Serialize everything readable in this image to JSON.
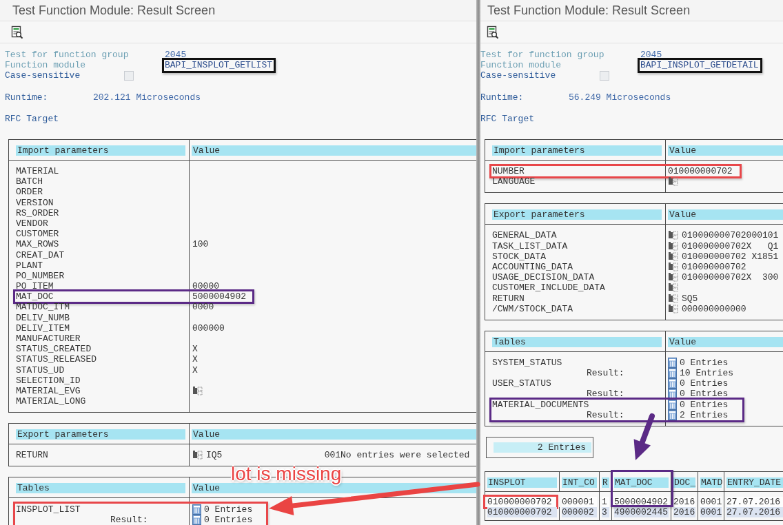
{
  "panes": [
    {
      "title": "Test Function Module: Result Screen",
      "group_label": "Test for function group",
      "group": "2045",
      "module_label": "Function module",
      "module": "BAPI_INSPLOT_GETLIST",
      "module_frame": {
        "color": "#111111"
      },
      "case_label": "Case-sensitive",
      "case_checked": false,
      "runtime_label": "Runtime:",
      "runtime": "202.121 Microseconds",
      "rfc": "RFC Target",
      "sections": [
        {
          "header": "Import parameters",
          "value_header": "Value",
          "rows": [
            {
              "kind": "plain",
              "name": "MATERIAL"
            },
            {
              "kind": "plain",
              "name": "BATCH"
            },
            {
              "kind": "plain",
              "name": "ORDER"
            },
            {
              "kind": "plain",
              "name": "VERSION"
            },
            {
              "kind": "plain",
              "name": "RS_ORDER"
            },
            {
              "kind": "plain",
              "name": "VENDOR"
            },
            {
              "kind": "plain",
              "name": "CUSTOMER"
            },
            {
              "kind": "plain",
              "name": "MAX_ROWS",
              "value": "100"
            },
            {
              "kind": "plain",
              "name": "CREAT_DAT"
            },
            {
              "kind": "plain",
              "name": "PLANT"
            },
            {
              "kind": "plain",
              "name": "PO_NUMBER"
            },
            {
              "kind": "plain",
              "name": "PO_ITEM",
              "value": "00000"
            },
            {
              "kind": "plain",
              "name": "MAT_DOC",
              "value": "5000004902",
              "color": "#5b2a86"
            },
            {
              "kind": "plain",
              "name": "MATDOC_ITM",
              "value": "0000"
            },
            {
              "kind": "plain",
              "name": "DELIV_NUMB"
            },
            {
              "kind": "plain",
              "name": "DELIV_ITEM",
              "value": "000000"
            },
            {
              "kind": "plain",
              "name": "MANUFACTURER"
            },
            {
              "kind": "plain",
              "name": "STATUS_CREATED",
              "value": "X"
            },
            {
              "kind": "plain",
              "name": "STATUS_RELEASED",
              "value": "X"
            },
            {
              "kind": "plain",
              "name": "STATUS_UD",
              "value": "X"
            },
            {
              "kind": "plain",
              "name": "SELECTION_ID"
            },
            {
              "kind": "struct",
              "name": "MATERIAL_EVG"
            },
            {
              "kind": "plain",
              "name": "MATERIAL_LONG"
            }
          ]
        },
        {
          "header": "Export parameters",
          "value_header": "Value",
          "rows": [
            {
              "kind": "struct",
              "name": "RETURN",
              "value": "IQ5                   001No entries were selected"
            }
          ]
        },
        {
          "header": "Tables",
          "value_header": "Value",
          "rows": [
            {
              "kind": "table",
              "name": "INSPLOT_LIST",
              "value": "0 Entries",
              "result_label": "Result:",
              "result_value": "0 Entries",
              "color": "#e8474a"
            }
          ]
        }
      ]
    },
    {
      "title": "Test Function Module: Result Screen",
      "group_label": "Test for function group",
      "group": "2045",
      "module_label": "Function module",
      "module": "BAPI_INSPLOT_GETDETAIL",
      "module_frame": {
        "color": "#111111"
      },
      "case_label": "Case-sensitive",
      "case_checked": false,
      "runtime_label": "Runtime:",
      "runtime": "56.249 Microseconds",
      "rfc": "RFC Target",
      "sections": [
        {
          "header": "Import parameters",
          "value_header": "Value",
          "rows": [
            {
              "kind": "plain",
              "name": "NUMBER",
              "value": "010000000702",
              "color": "#e8474a"
            },
            {
              "kind": "struct",
              "name": "LANGUAGE"
            }
          ]
        },
        {
          "header": "Export parameters",
          "value_header": "Value",
          "rows": [
            {
              "kind": "struct",
              "name": "GENERAL_DATA",
              "value": "010000000702000101"
            },
            {
              "kind": "struct",
              "name": "TASK_LIST_DATA",
              "value": "010000000702X   Q1"
            },
            {
              "kind": "struct",
              "name": "STOCK_DATA",
              "value": "010000000702 X1851"
            },
            {
              "kind": "struct",
              "name": "ACCOUNTING_DATA",
              "value": "010000000702"
            },
            {
              "kind": "struct",
              "name": "USAGE_DECISION_DATA",
              "value": "010000000702X  300"
            },
            {
              "kind": "struct",
              "name": "CUSTOMER_INCLUDE_DATA"
            },
            {
              "kind": "struct",
              "name": "RETURN",
              "value": "SQ5"
            },
            {
              "kind": "struct",
              "name": "/CWM/STOCK_DATA",
              "value": "000000000000"
            }
          ]
        },
        {
          "header": "Tables",
          "value_header": "Value",
          "rows": [
            {
              "kind": "table",
              "name": "SYSTEM_STATUS",
              "value": "0 Entries",
              "result_label": "Result:",
              "result_value": "10 Entries"
            },
            {
              "kind": "table",
              "name": "USER_STATUS",
              "value": "0 Entries",
              "result_label": "Result:",
              "result_value": "0 Entries"
            },
            {
              "kind": "table",
              "name": "MATERIAL_DOCUMENTS",
              "value": "0 Entries",
              "result_label": "Result:",
              "result_value": "2 Entries",
              "color": "#5b2a86"
            }
          ]
        }
      ],
      "entries_box": "2 Entries",
      "grid": {
        "columns": [
          {
            "label": "INSPLOT"
          },
          {
            "label": "INT_CO"
          },
          {
            "label": "R"
          },
          {
            "label": "MAT_DOC",
            "color": "#5b2a86"
          },
          {
            "label": "DOC_"
          },
          {
            "label": "MATD"
          },
          {
            "label": "ENTRY_DATE"
          }
        ],
        "rows": [
          {
            "cells": [
              {
                "text": "010000000702",
                "color": "#e8474a"
              },
              {
                "text": "000001"
              },
              {
                "text": "1"
              },
              {
                "text": "5000004902"
              },
              {
                "text": "2016"
              },
              {
                "text": "0001"
              },
              {
                "text": "27.07.2016"
              }
            ]
          },
          {
            "cells": [
              {
                "text": "010000000702"
              },
              {
                "text": "000002"
              },
              {
                "text": "3"
              },
              {
                "text": "4900002445"
              },
              {
                "text": "2016"
              },
              {
                "text": "0001"
              },
              {
                "text": "27.07.2016"
              }
            ]
          }
        ]
      }
    }
  ],
  "annotations": [
    {
      "kind": "label",
      "text": "lot is missing",
      "color": "#ea4443"
    },
    {
      "kind": "arrow",
      "color": "#ea4443"
    },
    {
      "kind": "arrow",
      "color": "#5b2a86"
    }
  ]
}
